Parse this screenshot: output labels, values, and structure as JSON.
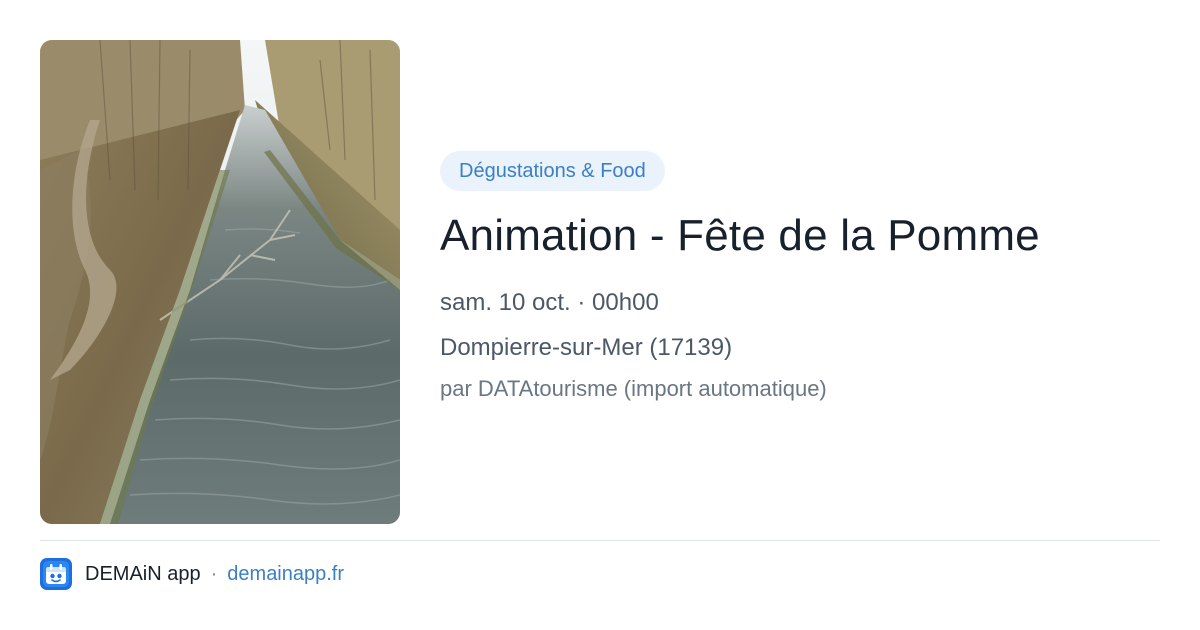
{
  "event": {
    "image_alt": "canal bordé d'arbres",
    "category": "Dégustations & Food",
    "title": "Animation - Fête de la Pomme",
    "datetime": "sam. 10 oct. · 00h00",
    "location": "Dompierre-sur-Mer (17139)",
    "source": "par DATAtourisme (import automatique)"
  },
  "footer": {
    "app_icon": "demain-app-icon",
    "app_name": "DEMAiN app",
    "separator": "·",
    "domain": "demainapp.fr"
  },
  "colors": {
    "accent": "#3b7fc4",
    "category_bg": "#eaf2fb",
    "title": "#17202b",
    "meta": "#4d5866",
    "muted": "#6b7684",
    "divider": "#dde4e6"
  }
}
